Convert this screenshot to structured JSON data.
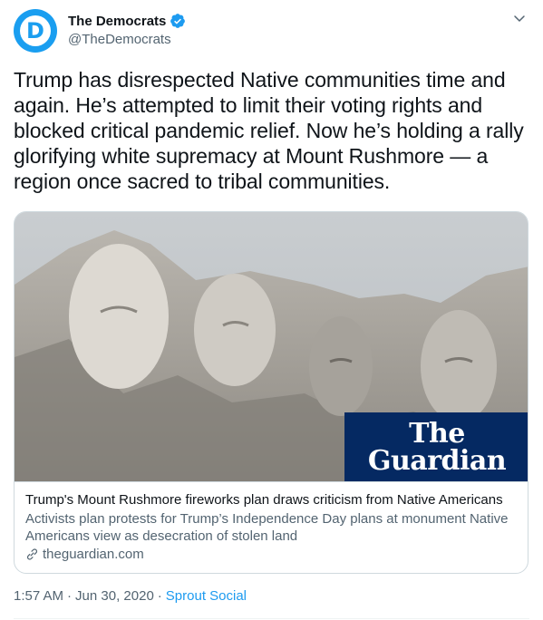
{
  "author": {
    "display_name": "The Democrats",
    "handle": "@TheDemocrats",
    "avatar_letter": "D",
    "avatar_color": "#1a9ef0",
    "verified": true
  },
  "tweet": {
    "text": "Trump has disrespected Native communities time and again. He’s attempted to limit their voting rights and blocked critical pandemic relief. Now he’s holding a rally glorifying white supremacy at Mount Rushmore — a region once sacred to tribal communities."
  },
  "card": {
    "image_icon": "mount-rushmore-photo",
    "brand_line1": "The",
    "brand_line2": "Guardian",
    "brand_color": "#052962",
    "title": "Trump's Mount Rushmore fireworks plan draws criticism from Native Americans",
    "description": "Activists plan protests for Trump’s Independence Day plans at monument Native Americans view as desecration of stolen land",
    "domain": "theguardian.com"
  },
  "meta": {
    "time": "1:57 AM",
    "separator1": "·",
    "date": "Jun 30, 2020",
    "separator2": "·",
    "source": "Sprout Social",
    "source_color": "#1d9bf0"
  }
}
